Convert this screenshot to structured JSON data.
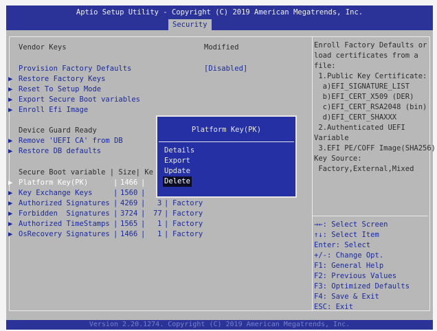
{
  "window": {
    "title": "Aptio Setup Utility - Copyright (C) 2019 American Megatrends, Inc.",
    "active_tab": "Security"
  },
  "main": {
    "vendor_keys_label": "Vendor Keys",
    "vendor_keys_value": "Modified",
    "provision_label": "Provision Factory Defaults",
    "provision_value": "[Disabled]",
    "menu_items": [
      "Restore Factory Keys",
      "Reset To Setup Mode",
      "Export Secure Boot variables",
      "Enroll Efi Image"
    ],
    "device_guard_label": "Device Guard Ready",
    "device_guard_items": [
      "Remove 'UEFI CA' from DB",
      "Restore DB defaults"
    ],
    "table_header": "Secure Boot variable | Size| Ke",
    "rows": [
      {
        "name": "Platform Key(PK)",
        "size": "1466",
        "keys": "",
        "source": ""
      },
      {
        "name": "Key Exchange Keys",
        "size": "1560",
        "keys": "",
        "source": ""
      },
      {
        "name": "Authorized Signatures",
        "size": "4269",
        "keys": "3",
        "source": "Factory"
      },
      {
        "name": "Forbidden  Signatures",
        "size": "3724",
        "keys": "77",
        "source": "Factory"
      },
      {
        "name": "Authorized TimeStamps",
        "size": "1565",
        "keys": "1",
        "source": "Factory"
      },
      {
        "name": "OsRecovery Signatures",
        "size": "1466",
        "keys": "1",
        "source": "Factory"
      }
    ]
  },
  "dialog": {
    "title": "Platform Key(PK)",
    "options": [
      "Details",
      "Export",
      "Update",
      "Delete"
    ],
    "selected": "Delete"
  },
  "help": {
    "lines": [
      "Enroll Factory Defaults or",
      "load certificates from a",
      "file:",
      " 1.Public Key Certificate:",
      "  a)EFI_SIGNATURE_LIST",
      "  b)EFI_CERT_X509 (DER)",
      "  c)EFI_CERT_RSA2048 (bin)",
      "  d)EFI_CERT_SHAXXX",
      " 2.Authenticated UEFI",
      "Variable",
      " 3.EFI PE/COFF Image(SHA256)",
      "Key Source:",
      " Factory,External,Mixed"
    ],
    "keys": [
      "→←: Select Screen",
      "↑↓: Select Item",
      "Enter: Select",
      "+/-: Change Opt.",
      "F1: General Help",
      "F2: Previous Values",
      "F3: Optimized Defaults",
      "F4: Save & Exit",
      "ESC: Exit"
    ]
  },
  "footer": "Version 2.20.1274. Copyright (C) 2019 American Megatrends, Inc.",
  "colors": {
    "header_blue": "#2b3398",
    "background_gray": "#b8b8b8",
    "highlight_blue": "#1a2a9a",
    "dialog_blue": "#2430a4"
  }
}
